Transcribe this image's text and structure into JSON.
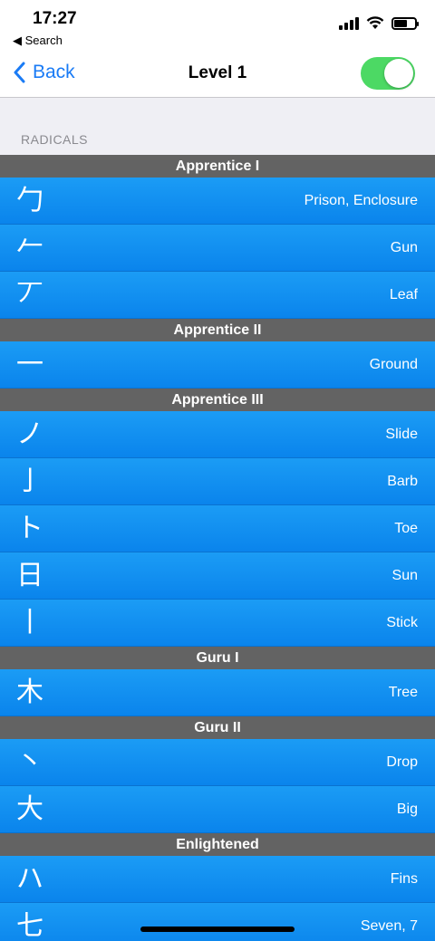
{
  "status": {
    "time": "17:27",
    "back_label": "◀ Search"
  },
  "nav": {
    "back_label": "Back",
    "title": "Level 1",
    "toggle_on": true
  },
  "section_header": "RADICALS",
  "groups": [
    {
      "name": "Apprentice I",
      "items": [
        {
          "char": "勹",
          "meaning": "Prison, Enclosure"
        },
        {
          "char": "𠂉",
          "meaning": "Gun"
        },
        {
          "char": "丆",
          "meaning": "Leaf"
        }
      ]
    },
    {
      "name": "Apprentice II",
      "items": [
        {
          "char": "一",
          "meaning": "Ground"
        }
      ]
    },
    {
      "name": "Apprentice III",
      "items": [
        {
          "char": "ノ",
          "meaning": "Slide"
        },
        {
          "char": "亅",
          "meaning": "Barb"
        },
        {
          "char": "ト",
          "meaning": "Toe"
        },
        {
          "char": "日",
          "meaning": "Sun"
        },
        {
          "char": "丨",
          "meaning": "Stick"
        }
      ]
    },
    {
      "name": "Guru I",
      "items": [
        {
          "char": "木",
          "meaning": "Tree"
        }
      ]
    },
    {
      "name": "Guru II",
      "items": [
        {
          "char": "丶",
          "meaning": "Drop"
        },
        {
          "char": "大",
          "meaning": "Big"
        }
      ]
    },
    {
      "name": "Enlightened",
      "items": [
        {
          "char": "ハ",
          "meaning": "Fins"
        },
        {
          "char": "七",
          "meaning": "Seven, 7"
        }
      ]
    }
  ]
}
